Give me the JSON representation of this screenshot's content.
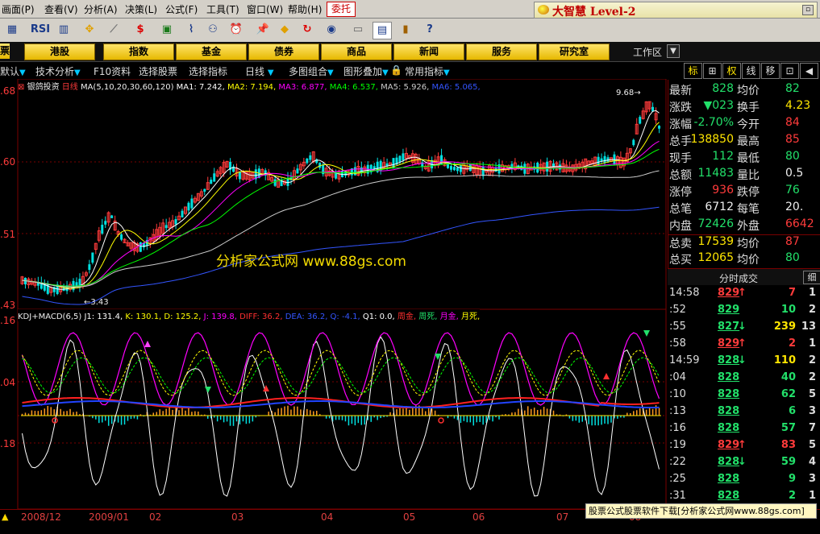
{
  "menu": {
    "items": [
      "画面(P)",
      "查看(V)",
      "分析(A)",
      "决策(L)",
      "公式(F)",
      "工具(T)",
      "窗口(W)",
      "帮助(H)"
    ],
    "weituo": "委托",
    "brand": "大智慧 Level-2"
  },
  "toolbar": {
    "icons": [
      "grid-icon",
      "rsi-icon",
      "bar-chart-icon",
      "move-icon",
      "ruler-icon",
      "dollar-icon",
      "flag-icon",
      "line-chart-icon",
      "binoculars-icon",
      "alarm-icon",
      "pin-icon",
      "warning-icon",
      "refresh-icon",
      "info-icon",
      "folder-icon",
      "window-icon",
      "books-icon",
      "help-icon"
    ],
    "rsi_label": "RSI"
  },
  "nav": {
    "buttons": [
      "港股",
      "指数",
      "基金",
      "债券",
      "商品",
      "新闻",
      "服务",
      "研究室"
    ],
    "workspace": "工作区"
  },
  "funcbar": {
    "items": [
      "默认",
      "技术分析",
      "F10资料",
      "选择股票",
      "选择指标",
      "日线",
      "多图组合",
      "图形叠加",
      "常用指标"
    ]
  },
  "right_tabs": [
    "标",
    "⊞",
    "权",
    "线",
    "移"
  ],
  "main_chart": {
    "stock_name": "银鸽投资",
    "period": "日线",
    "ma_params": "MA(5,10,20,30,60,120)",
    "ma_values": [
      {
        "label": "MA1: 7.242",
        "color": "#ffffff"
      },
      {
        "label": "MA2: 7.194",
        "color": "#ffff00"
      },
      {
        "label": "MA3: 6.877",
        "color": "#ff00ff"
      },
      {
        "label": "MA4: 6.537",
        "color": "#00ff00"
      },
      {
        "label": "MA5: 5.926",
        "color": "#cccccc"
      },
      {
        "label": "MA6: 5.065",
        "color": "#3355ff"
      }
    ],
    "y_ticks": [
      ".68",
      ".60",
      ".51",
      ".43"
    ],
    "low_label": "3.43",
    "high_label": "9.68",
    "watermark": "分析家公式网 www.88gs.com"
  },
  "indicator": {
    "name": "KDJ+MACD(6,5)",
    "values": [
      {
        "label": "J1: 131.4",
        "color": "#ffffff"
      },
      {
        "label": "K: 130.1",
        "color": "#ffff00"
      },
      {
        "label": "D: 125.2",
        "color": "#ffff00"
      },
      {
        "label": "J: 139.8",
        "color": "#ff00ff"
      },
      {
        "label": "DIFF: 36.2",
        "color": "#ff3030"
      },
      {
        "label": "DEA: 36.2",
        "color": "#3355ff"
      },
      {
        "label": "Q: -4.1",
        "color": "#3355ff"
      },
      {
        "label": "Q1: 0.0",
        "color": "#ffffff"
      },
      {
        "label": "周金",
        "color": "#ff3030"
      },
      {
        "label": "周死",
        "color": "#22e06a"
      },
      {
        "label": "月金",
        "color": "#ff00ff"
      },
      {
        "label": "月死",
        "color": "#ffff00"
      }
    ],
    "y_ticks": [
      ".16",
      ".04",
      ".18"
    ]
  },
  "quote": {
    "rows": [
      {
        "l1": "最新",
        "v1": "828",
        "c1": "#22e06a",
        "l2": "均价",
        "v2": "82",
        "c2": "#22e06a"
      },
      {
        "l1": "涨跌",
        "v1": "▼023",
        "c1": "#22e06a",
        "l2": "换手",
        "v2": "4.23",
        "c2": "#ffe600"
      },
      {
        "l1": "涨幅",
        "v1": "-2.70%",
        "c1": "#22e06a",
        "l2": "今开",
        "v2": "84",
        "c2": "#ff3b3b"
      },
      {
        "l1": "总手",
        "v1": "138850",
        "c1": "#ffe600",
        "l2": "最高",
        "v2": "85",
        "c2": "#ff3b3b"
      },
      {
        "l1": "现手",
        "v1": "112",
        "c1": "#22e06a",
        "l2": "最低",
        "v2": "80",
        "c2": "#22e06a"
      },
      {
        "l1": "总额",
        "v1": "11483",
        "c1": "#22e06a",
        "l2": "量比",
        "v2": "0.5",
        "c2": "#eeeeee"
      },
      {
        "l1": "涨停",
        "v1": "936",
        "c1": "#ff3b3b",
        "l2": "跌停",
        "v2": "76",
        "c2": "#22e06a"
      },
      {
        "l1": "总笔",
        "v1": "6712",
        "c1": "#eeeeee",
        "l2": "每笔",
        "v2": "20.",
        "c2": "#eeeeee"
      },
      {
        "l1": "内盘",
        "v1": "72426",
        "c1": "#22e06a",
        "l2": "外盘",
        "v2": "6642",
        "c2": "#ff3b3b"
      },
      {
        "l1": "总卖",
        "v1": "17539",
        "c1": "#ffe600",
        "l2": "均价",
        "v2": "87",
        "c2": "#ff3b3b"
      },
      {
        "l1": "总买",
        "v1": "12065",
        "c1": "#ffe600",
        "l2": "均价",
        "v2": "80",
        "c2": "#22e06a"
      }
    ]
  },
  "trades": {
    "title": "分时成交",
    "tab2": "细",
    "rows": [
      {
        "time": "14:58",
        "price": "829",
        "dir": "up",
        "vol": "7",
        "cnt": "1"
      },
      {
        "time": ":52",
        "price": "829",
        "dir": "",
        "vol": "10",
        "cnt": "2"
      },
      {
        "time": ":55",
        "price": "827",
        "dir": "down",
        "vol": "239",
        "cnt": "13"
      },
      {
        "time": ":58",
        "price": "829",
        "dir": "up",
        "vol": "2",
        "cnt": "1"
      },
      {
        "time": "14:59",
        "price": "828",
        "dir": "down",
        "vol": "110",
        "cnt": "2"
      },
      {
        "time": ":04",
        "price": "828",
        "dir": "",
        "vol": "40",
        "cnt": "2"
      },
      {
        "time": ":10",
        "price": "828",
        "dir": "",
        "vol": "62",
        "cnt": "5"
      },
      {
        "time": ":13",
        "price": "828",
        "dir": "",
        "vol": "6",
        "cnt": "3"
      },
      {
        "time": ":16",
        "price": "828",
        "dir": "",
        "vol": "57",
        "cnt": "7"
      },
      {
        "time": ":19",
        "price": "829",
        "dir": "up",
        "vol": "83",
        "cnt": "5"
      },
      {
        "time": ":22",
        "price": "828",
        "dir": "down",
        "vol": "59",
        "cnt": "4"
      },
      {
        "time": ":25",
        "price": "828",
        "dir": "",
        "vol": "9",
        "cnt": "3"
      },
      {
        "time": ":31",
        "price": "828",
        "dir": "",
        "vol": "2",
        "cnt": "1"
      }
    ]
  },
  "date_axis": {
    "labels": [
      "2008/12",
      "2009/01",
      "02",
      "03",
      "04",
      "05",
      "06",
      "07",
      "08"
    ]
  },
  "ad_banner": "股票公式股票软件下载[分析家公式网www.88gs.com]"
}
